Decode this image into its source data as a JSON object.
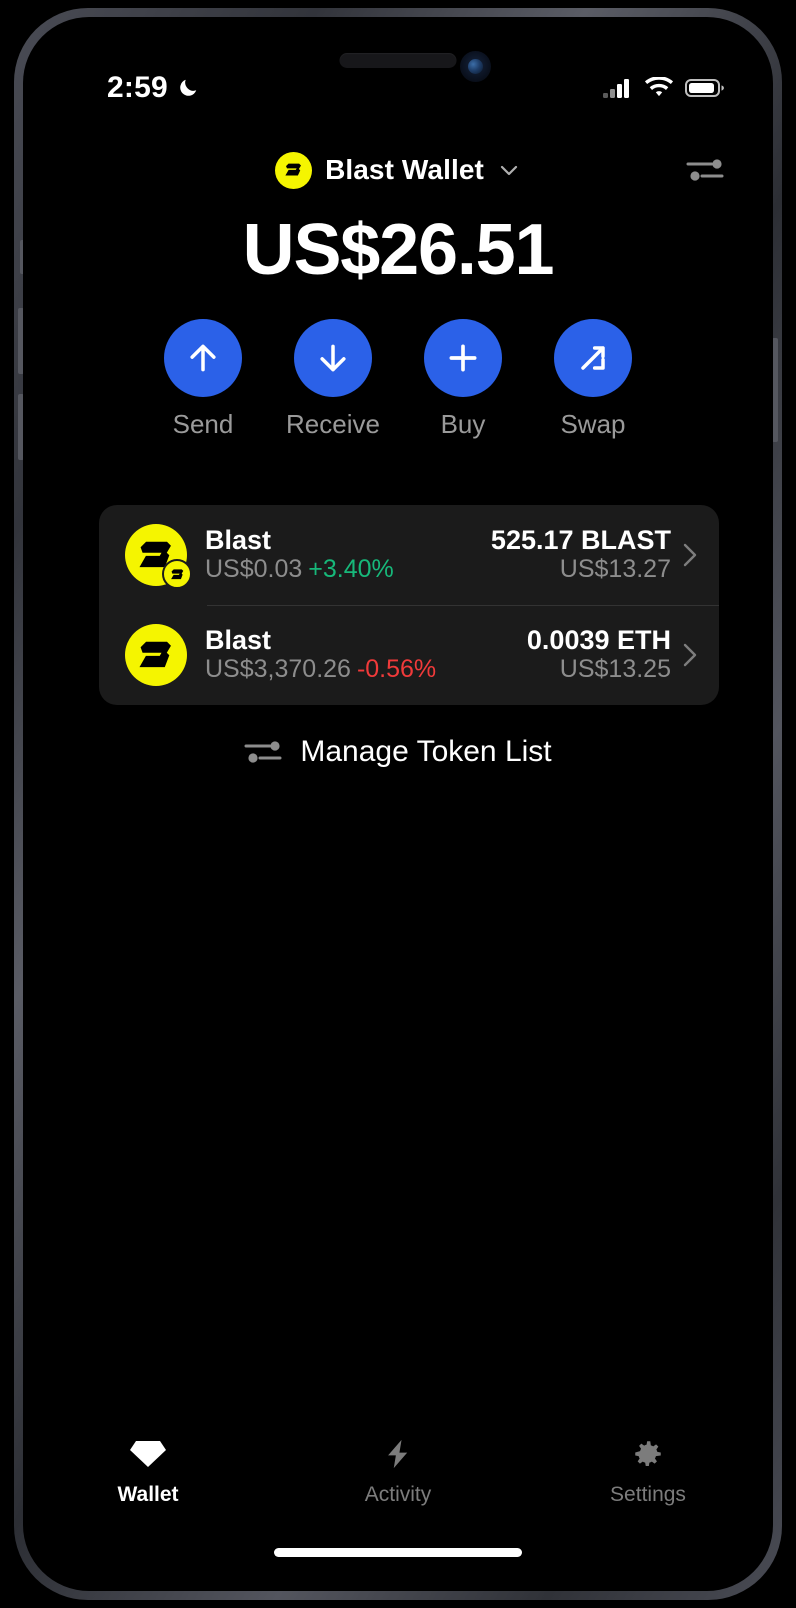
{
  "status_bar": {
    "time": "2:59",
    "dnd_icon": "crescent-moon-icon",
    "cellular_icon": "cellular-signal-icon",
    "wifi_icon": "wifi-icon",
    "battery_icon": "battery-icon"
  },
  "header": {
    "wallet_name": "Blast Wallet",
    "logo_icon": "blast-logo-icon",
    "chevron_icon": "chevron-down-icon",
    "filter_icon": "sliders-icon"
  },
  "balance": {
    "total": "US$26.51"
  },
  "actions": [
    {
      "label": "Send",
      "icon": "arrow-up-icon"
    },
    {
      "label": "Receive",
      "icon": "arrow-down-icon"
    },
    {
      "label": "Buy",
      "icon": "plus-icon"
    },
    {
      "label": "Swap",
      "icon": "swap-arrows-icon"
    }
  ],
  "tokens": [
    {
      "name": "Blast",
      "price": "US$0.03",
      "change": "+3.40%",
      "change_direction": "up",
      "amount": "525.17 BLAST",
      "fiat": "US$13.27",
      "logo_icon": "blast-token-icon",
      "has_network_badge": true,
      "chevron_icon": "chevron-right-icon"
    },
    {
      "name": "Blast",
      "price": "US$3,370.26",
      "change": "-0.56%",
      "change_direction": "down",
      "amount": "0.0039 ETH",
      "fiat": "US$13.25",
      "logo_icon": "blast-token-icon",
      "has_network_badge": false,
      "chevron_icon": "chevron-right-icon"
    }
  ],
  "manage_tokens": {
    "label": "Manage Token List",
    "icon": "sliders-icon"
  },
  "bottom_nav": [
    {
      "label": "Wallet",
      "icon": "diamond-icon",
      "active": true
    },
    {
      "label": "Activity",
      "icon": "lightning-icon",
      "active": false
    },
    {
      "label": "Settings",
      "icon": "gear-icon",
      "active": false
    }
  ],
  "colors": {
    "accent_blue": "#2b61e8",
    "brand_yellow": "#f5f500",
    "positive_green": "#17b87a",
    "negative_red": "#f03a3a",
    "card_background": "#1b1b1b"
  }
}
